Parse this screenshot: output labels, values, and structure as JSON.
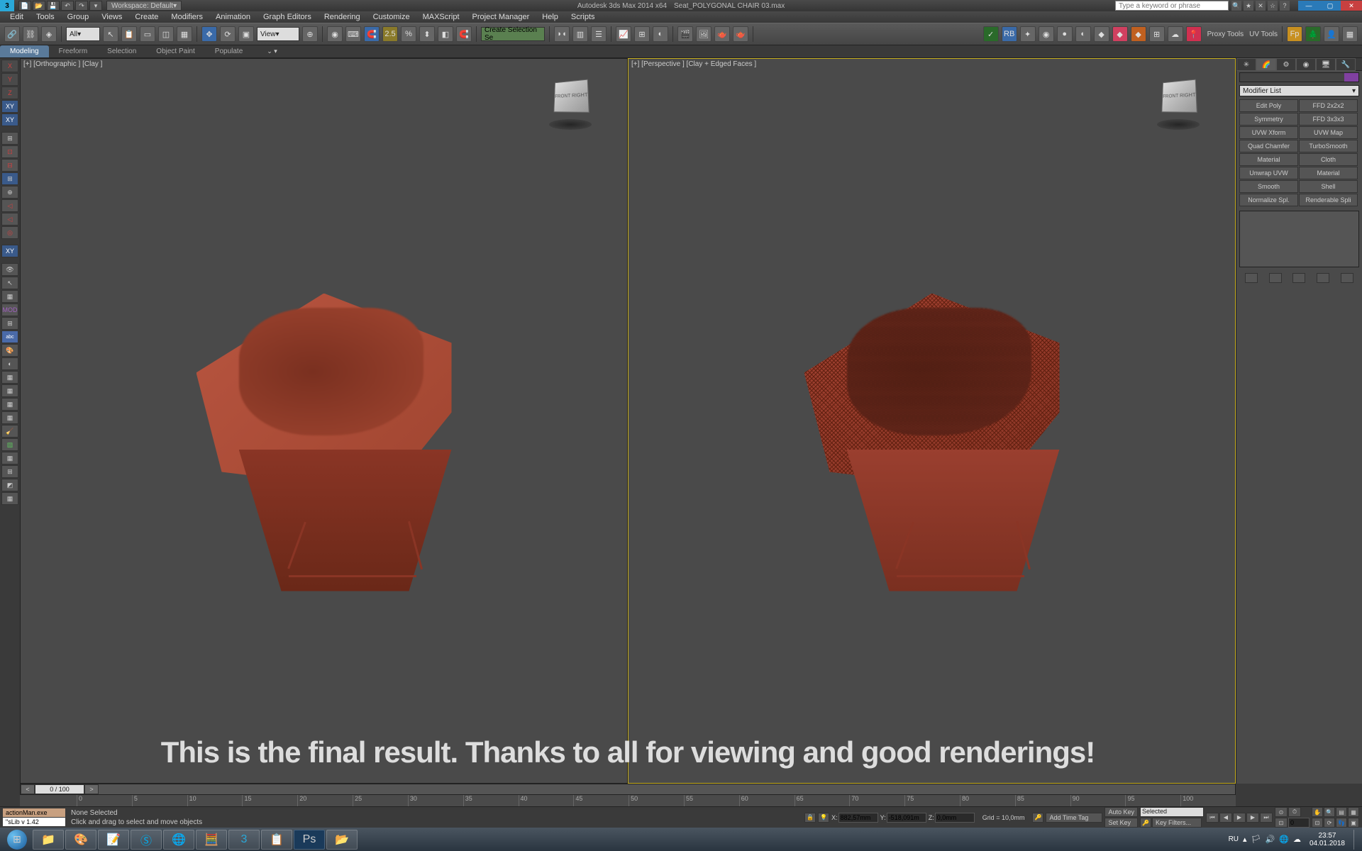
{
  "titlebar": {
    "workspace": "Workspace: Default",
    "app": "Autodesk 3ds Max  2014 x64",
    "file": "Seat_POLYGONAL CHAIR 03.max",
    "search_placeholder": "Type a keyword or phrase"
  },
  "menu": [
    "Edit",
    "Tools",
    "Group",
    "Views",
    "Create",
    "Modifiers",
    "Animation",
    "Graph Editors",
    "Rendering",
    "Customize",
    "MAXScript",
    "Project Manager",
    "Help",
    "Scripts"
  ],
  "toolbar": {
    "sel_filter": "All",
    "view_combo": "View",
    "named_sel": "Create Selection Se",
    "spin1": "2.5",
    "proxy": "Proxy Tools",
    "uvtools": "UV Tools"
  },
  "ribbon": {
    "tabs": [
      "Modeling",
      "Freeform",
      "Selection",
      "Object Paint",
      "Populate"
    ]
  },
  "viewports": {
    "left": "[+] [Orthographic ] [Clay ]",
    "right": "[+] [Perspective ] [Clay + Edged Faces ]",
    "cube_label": "FRONT  RIGHT"
  },
  "left_axis": [
    "X",
    "Y",
    "Z",
    "XY",
    "XY"
  ],
  "right_panel": {
    "modifier_list": "Modifier List",
    "buttons": [
      "Edit Poly",
      "FFD 2x2x2",
      "Symmetry",
      "FFD 3x3x3",
      "UVW Xform",
      "UVW Map",
      "Quad Chamfer",
      "TurboSmooth",
      "Material",
      "Cloth",
      "Unwrap UVW",
      "Material",
      "Smooth",
      "Shell",
      "Normalize Spl.",
      "Renderable Spli"
    ]
  },
  "overlay": "This is the final result. Thanks to all for viewing and good renderings!",
  "timeline": {
    "frame": "0 / 100",
    "ticks": [
      "0",
      "5",
      "10",
      "15",
      "20",
      "25",
      "30",
      "35",
      "40",
      "45",
      "50",
      "55",
      "60",
      "65",
      "70",
      "75",
      "80",
      "85",
      "90",
      "95",
      "100"
    ]
  },
  "status": {
    "script1": "actionMan.exe",
    "script2": "\"sLib v 1.42",
    "selection": "None Selected",
    "hint": "Click and drag to select and move objects",
    "x": "882,57mm",
    "y": "-518,091m",
    "z": "0,0mm",
    "grid": "Grid = 10,0mm",
    "add_time_tag": "Add Time Tag",
    "autokey": "Auto Key",
    "setkey": "Set Key",
    "selected": "Selected",
    "keyfilters": "Key Filters...",
    "framefield": "0"
  },
  "taskbar": {
    "lang": "RU",
    "time": "23:57",
    "date": "04.01.2018"
  }
}
